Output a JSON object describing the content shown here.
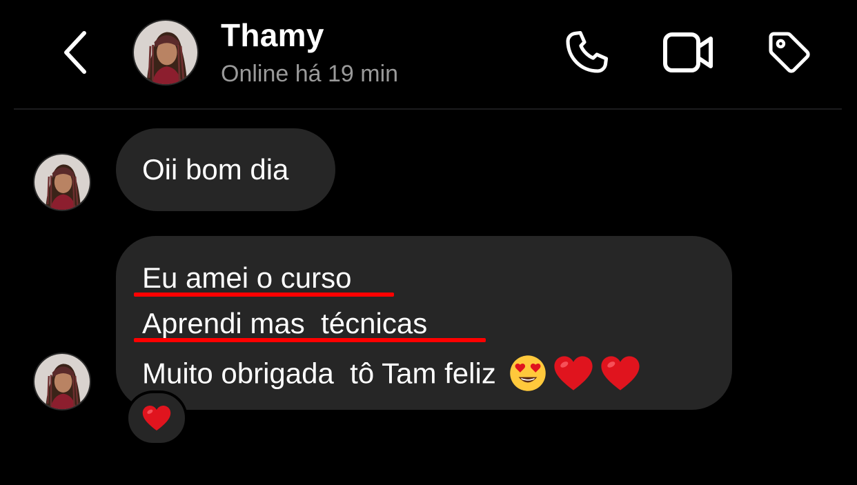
{
  "header": {
    "contact_name": "Thamy",
    "status": "Online há 19 min",
    "icons": {
      "back": "chevron-left-icon",
      "call": "phone-icon",
      "video": "video-camera-icon",
      "tag": "tag-icon"
    }
  },
  "messages": [
    {
      "lines": [
        "Oii bom dia"
      ]
    },
    {
      "lines": [
        "Eu amei o curso ",
        "Aprendi mas  técnicas",
        "Muito obrigada  tô Tam feliz"
      ],
      "emojis": [
        "heart-eyes-emoji",
        "red-heart-emoji",
        "red-heart-emoji"
      ],
      "reaction": "red-heart-emoji"
    }
  ],
  "colors": {
    "background": "#000000",
    "bubble": "#262626",
    "status_text": "#9a9a9a",
    "annotation_underline": "#ff0000",
    "heart": "#e0141e"
  }
}
